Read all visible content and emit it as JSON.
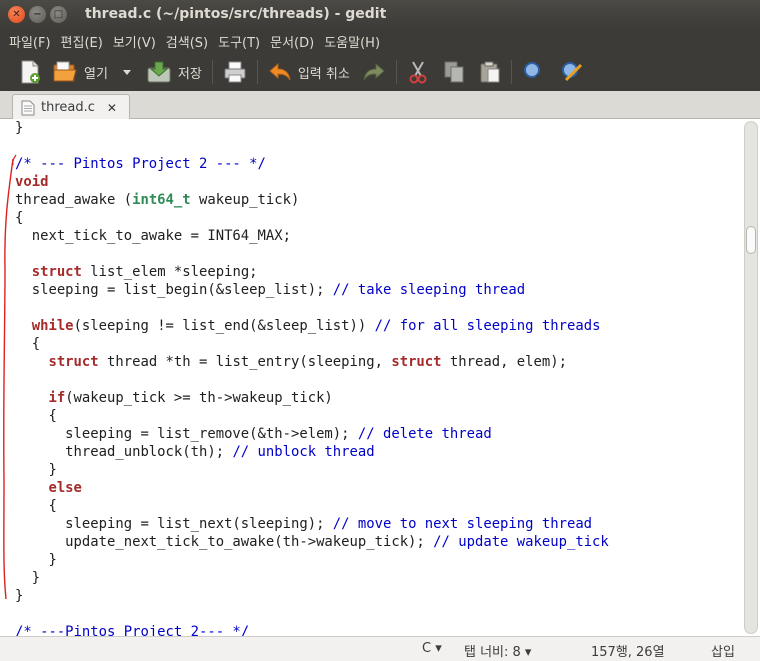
{
  "window": {
    "title": "thread.c (~/pintos/src/threads) - gedit"
  },
  "menu": [
    "파일(F)",
    "편집(E)",
    "보기(V)",
    "검색(S)",
    "도구(T)",
    "문서(D)",
    "도움말(H)"
  ],
  "toolbar": {
    "open_label": "열기",
    "save_label": "저장",
    "undo_label": "입력 취소"
  },
  "tab": {
    "filename": "thread.c",
    "close_glyph": "✕"
  },
  "code_lines": [
    [
      [
        "",
        "}"
      ]
    ],
    [],
    [
      [
        "cm",
        "/* --- Pintos Project 2 --- */"
      ]
    ],
    [
      [
        "kw",
        "void"
      ]
    ],
    [
      [
        "",
        "thread_awake ("
      ],
      [
        "ty",
        "int64_t"
      ],
      [
        "",
        " wakeup_tick)"
      ]
    ],
    [
      [
        "",
        "{"
      ]
    ],
    [
      [
        "",
        "  next_tick_to_awake = INT64_MAX;"
      ]
    ],
    [],
    [
      [
        "",
        "  "
      ],
      [
        "kw",
        "struct"
      ],
      [
        "",
        " list_elem *sleeping;"
      ]
    ],
    [
      [
        "",
        "  sleeping = list_begin(&sleep_list); "
      ],
      [
        "cm",
        "// take sleeping thread"
      ]
    ],
    [],
    [
      [
        "",
        "  "
      ],
      [
        "kw",
        "while"
      ],
      [
        "",
        "(sleeping != list_end(&sleep_list)) "
      ],
      [
        "cm",
        "// for all sleeping threads"
      ]
    ],
    [
      [
        "",
        "  {"
      ]
    ],
    [
      [
        "",
        "    "
      ],
      [
        "kw",
        "struct"
      ],
      [
        "",
        " thread *th = list_entry(sleeping, "
      ],
      [
        "kw",
        "struct"
      ],
      [
        "",
        " thread, elem);"
      ]
    ],
    [],
    [
      [
        "",
        "    "
      ],
      [
        "kw",
        "if"
      ],
      [
        "",
        "(wakeup_tick >= th->wakeup_tick)"
      ]
    ],
    [
      [
        "",
        "    {"
      ]
    ],
    [
      [
        "",
        "      sleeping = list_remove(&th->elem); "
      ],
      [
        "cm",
        "// delete thread"
      ]
    ],
    [
      [
        "",
        "      thread_unblock(th); "
      ],
      [
        "cm",
        "// unblock thread"
      ]
    ],
    [
      [
        "",
        "    }"
      ]
    ],
    [
      [
        "",
        "    "
      ],
      [
        "kw",
        "else"
      ]
    ],
    [
      [
        "",
        "    {"
      ]
    ],
    [
      [
        "",
        "      sleeping = list_next(sleeping); "
      ],
      [
        "cm",
        "// move to next sleeping thread"
      ]
    ],
    [
      [
        "",
        "      update_next_tick_to_awake(th->wakeup_tick); "
      ],
      [
        "cm",
        "// update wakeup_tick"
      ]
    ],
    [
      [
        "",
        "    }"
      ]
    ],
    [
      [
        "",
        "  }"
      ]
    ],
    [
      [
        "",
        "}"
      ]
    ],
    [],
    [
      [
        "cm",
        "/* ---Pintos Project 2--- */"
      ]
    ]
  ],
  "status": {
    "language": "C ▾",
    "tab_width": "탭 너비: 8 ▾",
    "position": "157행, 26열",
    "mode": "삽입"
  },
  "colors": {
    "keyword": "#a52a2a",
    "type": "#2e8b57",
    "comment": "#0000c8",
    "annotation": "#e02020"
  }
}
